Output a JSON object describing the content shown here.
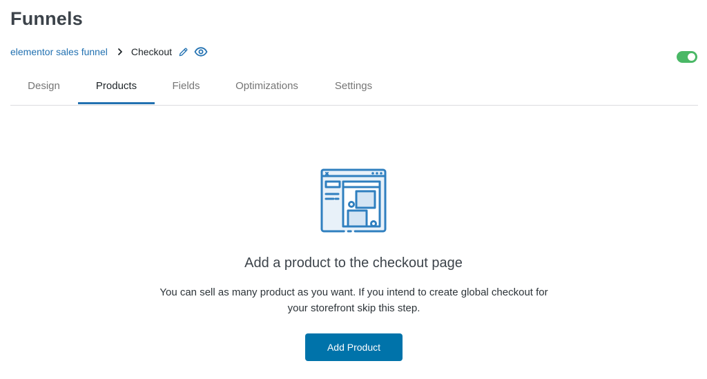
{
  "page": {
    "title": "Funnels"
  },
  "breadcrumb": {
    "parent": "elementor sales funnel",
    "separator_icon": "chevron-right-icon",
    "current": "Checkout",
    "edit_icon": "pencil-icon",
    "view_icon": "eye-icon"
  },
  "status_toggle": {
    "enabled": true,
    "color": "#4ab866"
  },
  "tabs": [
    {
      "label": "Design",
      "active": false
    },
    {
      "label": "Products",
      "active": true
    },
    {
      "label": "Fields",
      "active": false
    },
    {
      "label": "Optimizations",
      "active": false
    },
    {
      "label": "Settings",
      "active": false
    }
  ],
  "empty_state": {
    "icon": "checkout-page-illustration",
    "title": "Add a product to the checkout page",
    "description_line1": "You can sell as many product as you want. If you intend to create global checkout for",
    "description_line2": "your storefront skip this step.",
    "button_label": "Add Product"
  },
  "colors": {
    "accent": "#2271b1",
    "button": "#0073aa",
    "toggle_on": "#4ab866",
    "illustration_stroke": "#2f7fbf",
    "illustration_fill": "#e8f1f9"
  }
}
